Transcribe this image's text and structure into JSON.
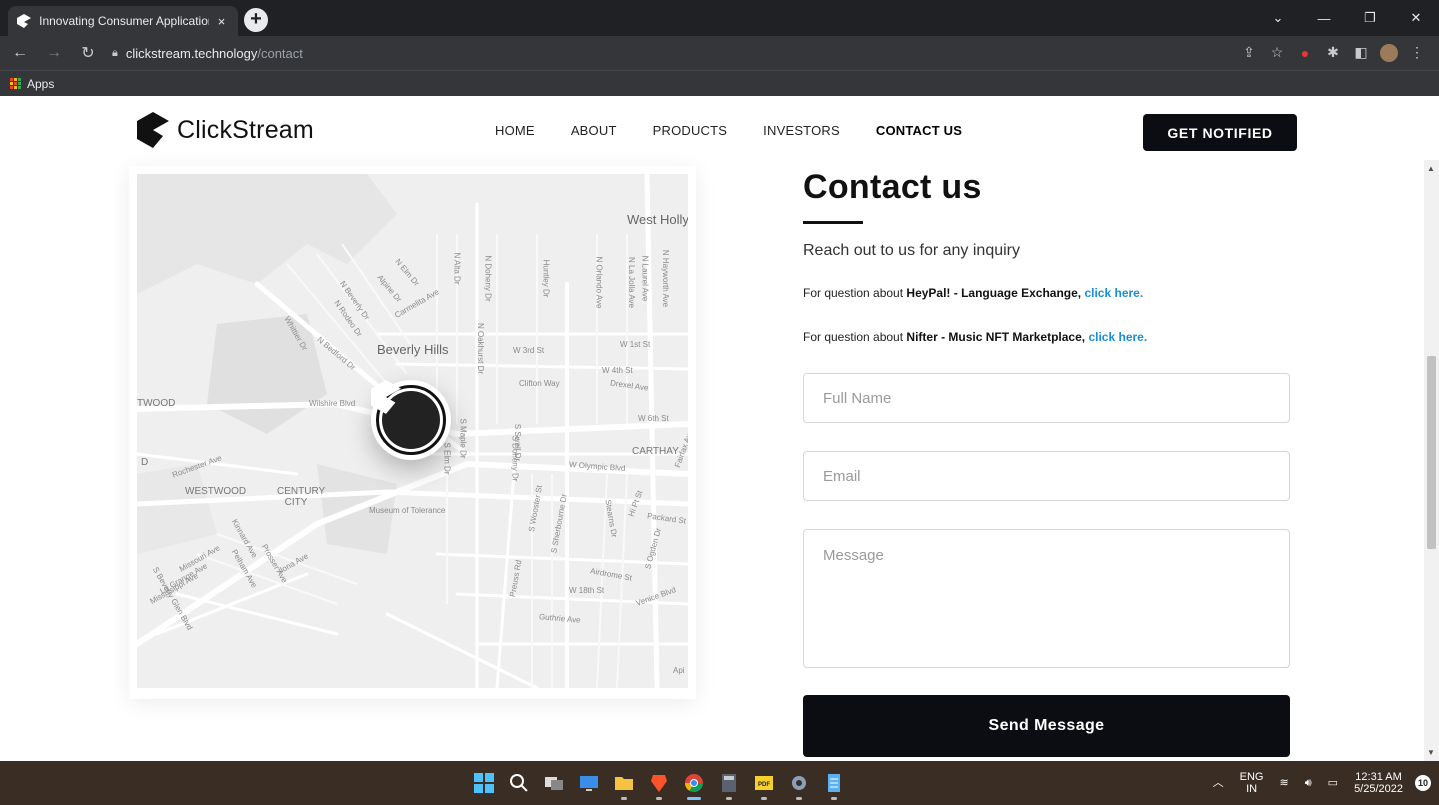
{
  "browser": {
    "tab_title": "Innovating Consumer Application",
    "tab_close": "×",
    "new_tab": "+",
    "window_controls": [
      "⌄",
      "—",
      "❐",
      "✕"
    ],
    "url_host": "clickstream.technology",
    "url_path": "/contact",
    "bookmarks": [
      {
        "label": "Apps"
      }
    ]
  },
  "site": {
    "logo_text": "ClickStream",
    "nav": [
      {
        "label": "HOME"
      },
      {
        "label": "ABOUT"
      },
      {
        "label": "PRODUCTS"
      },
      {
        "label": "INVESTORS"
      },
      {
        "label": "CONTACT US",
        "active": true
      }
    ],
    "cta_label": "GET NOTIFIED"
  },
  "map": {
    "labels": [
      "West Holly",
      "Beverly Hills",
      "Wilshire Blvd",
      "W 3rd St",
      "W 1st St",
      "W 4th St",
      "Drexel Ave",
      "W 6th St",
      "Clifton Way",
      "Carmelita Ave",
      "N Rodeo Dr",
      "N Bedford Dr",
      "N Beverly Dr",
      "Alpine Dr",
      "N Elm Dr",
      "Whittier Dr",
      "N Alta Dr",
      "N Doheny Dr",
      "Huntley Dr",
      "N Orlando Ave",
      "N La Jolla Ave",
      "N Laurel Ave",
      "N Hayworth Ave",
      "N Oakhurst Dr",
      "S Maple Dr",
      "S Elm Dr",
      "S Doheny Dr",
      "S Swall Dr",
      "CARTHAY",
      "W Olympic Blvd",
      "Fairfax Ave",
      "Hi Pt St",
      "Packard St",
      "Museum of Tolerance",
      "WESTWOOD",
      "CENTURY CITY",
      "TWOOD",
      "Rochester Ave",
      "S Wooster St",
      "S Sherbourne Dr",
      "Stearns Dr",
      "S Ogden Dr",
      "Airdrome St",
      "W 18th St",
      "Venice Blvd",
      "Preuss Rd",
      "Guthrie Ave",
      "Missouri Ave",
      "La Grange Ave",
      "Mississippi Ave",
      "Pelham Ave",
      "Prosser Ave",
      "Kinnard Ave",
      "Ilona Ave",
      "S Beverly Glen Blvd",
      "D",
      "Api"
    ]
  },
  "contact": {
    "title": "Contact us",
    "subtitle": "Reach out to us for any inquiry",
    "q1_prefix": "For question about ",
    "q1_product": "HeyPal! - Language Exchange,",
    "q1_link": "click here.",
    "q2_prefix": "For question about ",
    "q2_product": "Nifter - Music NFT Marketplace,",
    "q2_link": "click here.",
    "name_placeholder": "Full Name",
    "email_placeholder": "Email",
    "message_placeholder": "Message",
    "send_label": "Send Message"
  },
  "taskbar": {
    "lang_top": "ENG",
    "lang_bottom": "IN",
    "time": "12:31 AM",
    "date": "5/25/2022",
    "notifications": "10"
  }
}
